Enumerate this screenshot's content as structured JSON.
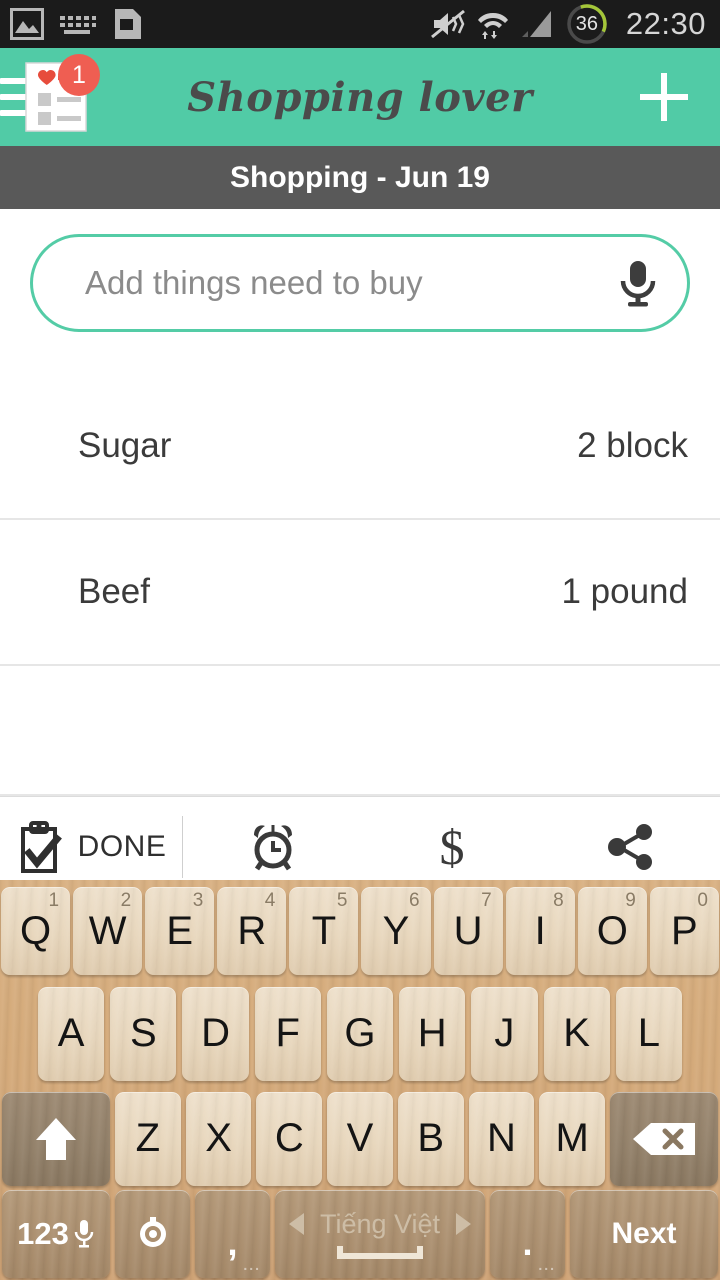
{
  "status_bar": {
    "time": "22:30",
    "battery_percent": "36",
    "left_icons": [
      "gallery-icon",
      "keyboard-icon",
      "sim-card-icon"
    ],
    "right_icons": [
      "mute-vibrate-icon",
      "wifi-icon",
      "cellular-signal-icon",
      "battery-icon"
    ],
    "background_color": "#1b1b1b"
  },
  "app_bar": {
    "title": "Shopping lover",
    "badge_count": "1",
    "menu_icon": "hamburger-menu-icon",
    "logo_icon": "shopping-list-heart-icon",
    "add_icon": "plus-icon",
    "background_color": "#51cba6",
    "title_color": "#4b4b4b",
    "badge_color": "#ef5e52"
  },
  "subtitle_bar": {
    "text": "Shopping - Jun 19",
    "background_color": "#595959"
  },
  "add_input": {
    "placeholder": "Add things need to buy",
    "value": "",
    "mic_icon": "microphone-icon",
    "border_color": "#54cca6"
  },
  "list": {
    "items": [
      {
        "name": "Sugar",
        "quantity": "2 block"
      },
      {
        "name": "Beef",
        "quantity": "1 pound"
      }
    ]
  },
  "action_bar": {
    "done_label": "DONE",
    "done_icon": "clipboard-check-icon",
    "alarm_icon": "alarm-clock-icon",
    "price_icon": "dollar-sign-icon",
    "share_icon": "share-icon"
  },
  "keyboard": {
    "row1": [
      {
        "label": "Q",
        "num": "1"
      },
      {
        "label": "W",
        "num": "2"
      },
      {
        "label": "E",
        "num": "3"
      },
      {
        "label": "R",
        "num": "4"
      },
      {
        "label": "T",
        "num": "5"
      },
      {
        "label": "Y",
        "num": "6"
      },
      {
        "label": "U",
        "num": "7"
      },
      {
        "label": "I",
        "num": "8"
      },
      {
        "label": "O",
        "num": "9"
      },
      {
        "label": "P",
        "num": "0"
      }
    ],
    "row2": [
      {
        "label": "A"
      },
      {
        "label": "S"
      },
      {
        "label": "D"
      },
      {
        "label": "F"
      },
      {
        "label": "G"
      },
      {
        "label": "H"
      },
      {
        "label": "J"
      },
      {
        "label": "K"
      },
      {
        "label": "L"
      }
    ],
    "row3": [
      {
        "label": "Z"
      },
      {
        "label": "X"
      },
      {
        "label": "C"
      },
      {
        "label": "V"
      },
      {
        "label": "B"
      },
      {
        "label": "N"
      },
      {
        "label": "M"
      }
    ],
    "shift_icon": "shift-arrow-icon",
    "backspace_icon": "backspace-delete-icon",
    "numeric_label": "123",
    "numeric_mic_icon": "microphone-icon",
    "settings_icon": "keyboard-settings-icon",
    "comma_label": ",",
    "period_label": ".",
    "space_label": "Tiếng Việt",
    "space_prev_icon": "arrow-left-icon",
    "space_next_icon": "arrow-right-icon",
    "enter_label": "Next"
  }
}
